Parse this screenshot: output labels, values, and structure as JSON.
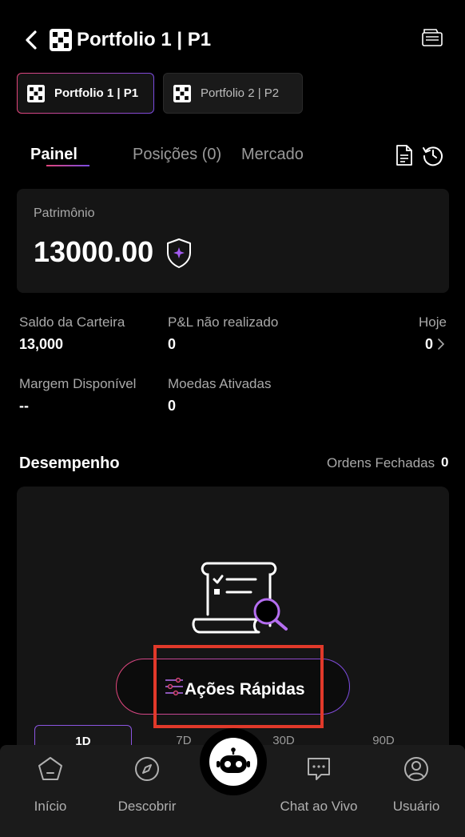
{
  "header": {
    "title": "Portfolio 1 | P1",
    "back_icon": "chevron-left-icon",
    "logo_icon": "okx-logo-icon",
    "wallet_icon": "wallet-icon"
  },
  "portfolio_tabs": [
    {
      "label": "Portfolio 1 | P1",
      "active": true
    },
    {
      "label": "Portfolio 2 | P2",
      "active": false
    }
  ],
  "nav_tabs": [
    {
      "label": "Painel",
      "active": true
    },
    {
      "label": "Posições (0)",
      "active": false
    },
    {
      "label": "Mercado",
      "active": false
    }
  ],
  "equity": {
    "label": "Patrimônio",
    "value": "13000.00"
  },
  "stats": {
    "wallet_balance": {
      "label": "Saldo da Carteira",
      "value": "13,000"
    },
    "unrealized_pnl": {
      "label": "P&L não realizado",
      "value": "0"
    },
    "today": {
      "label": "Hoje",
      "value": "0"
    },
    "available_margin": {
      "label": "Margem Disponível",
      "value": "--"
    },
    "active_coins": {
      "label": "Moedas Ativadas",
      "value": "0"
    }
  },
  "performance": {
    "title": "Desempenho",
    "closed_orders_label": "Ordens Fechadas",
    "closed_orders_value": "0"
  },
  "quick_actions": {
    "label": "Ações Rápidas"
  },
  "range_tabs": [
    "1D",
    "7D",
    "30D",
    "90D"
  ],
  "bottom_nav": [
    {
      "label": "Início",
      "icon": "home-icon"
    },
    {
      "label": "Descobrir",
      "icon": "compass-icon"
    },
    {
      "label": "Chat ao Vivo",
      "icon": "chat-icon"
    },
    {
      "label": "Usuário",
      "icon": "user-icon"
    }
  ],
  "colors": {
    "accent_pink": "#e0457a",
    "accent_purple": "#7a4be0",
    "highlight_red": "#e1392a",
    "card_bg": "#151515"
  }
}
